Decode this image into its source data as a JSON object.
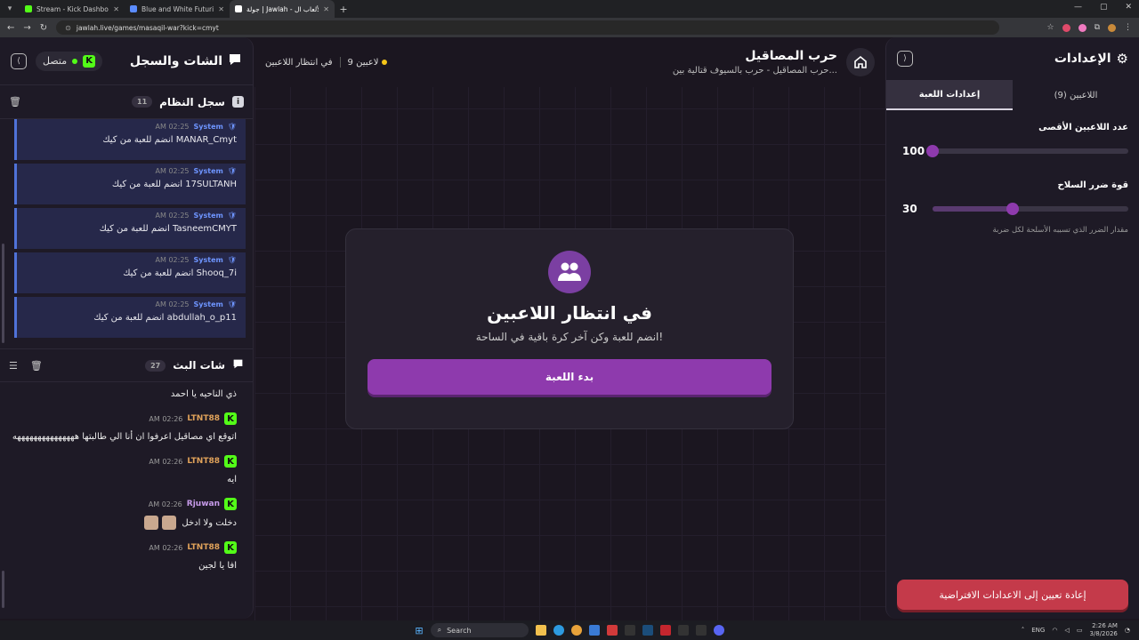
{
  "browser": {
    "tabs": [
      {
        "title": "Stream - Kick Dashboard",
        "color": "#53fc18"
      },
      {
        "title": "Blue and White Futuristic Modi",
        "color": "#5b8cff"
      },
      {
        "title": "جولة | Jawlah - منصة الألعاب ال",
        "color": "#ffffff"
      }
    ],
    "url": "jawlah.live/games/masaqil-war?kick=cmyt"
  },
  "chat_panel": {
    "title": "الشات والسجل",
    "connection": "متصل",
    "system_log": {
      "title": "سجل النظام",
      "count": "11",
      "entries": [
        {
          "sender": "System",
          "time": "02:25 AM",
          "message": "MANAR_Cmyt انضم للعبة من كيك"
        },
        {
          "sender": "System",
          "time": "02:25 AM",
          "message": "17SULTANH انضم للعبة من كيك"
        },
        {
          "sender": "System",
          "time": "02:25 AM",
          "message": "TasneemCMYT انضم للعبة من كيك"
        },
        {
          "sender": "System",
          "time": "02:25 AM",
          "message": "Shooq_7i انضم للعبة من كيك"
        },
        {
          "sender": "System",
          "time": "02:25 AM",
          "message": "abdullah_o_p11 انضم للعبة من كيك"
        }
      ]
    },
    "stream_chat": {
      "title": "شات البث",
      "count": "27",
      "messages": [
        {
          "user": "",
          "time": "",
          "text": "ذي الناحيه يا احمد",
          "color": "#e0a25a"
        },
        {
          "user": "LTNT88",
          "time": "02:26 AM",
          "text": "اتوقع اي مصاقيل اعرفوا ان أنا الي طالبتها هههههههههههههههه",
          "color": "#e0a25a"
        },
        {
          "user": "LTNT88",
          "time": "02:26 AM",
          "text": "ايه",
          "color": "#e0a25a"
        },
        {
          "user": "Rjuwan",
          "time": "02:26 AM",
          "text": "دخلت ولا ادخل",
          "color": "#c79bea"
        },
        {
          "user": "LTNT88",
          "time": "02:26 AM",
          "text": "افا يا لجين",
          "color": "#e0a25a"
        }
      ]
    }
  },
  "game": {
    "title": "حرب المصاقيل",
    "subtitle": "حرب المصاقيل - حرب بالسيوف قتالية بين...",
    "players": "9 لاعبين",
    "status": "في انتظار اللاعبين",
    "card_title": "في انتظار اللاعبين",
    "card_desc": "انضم للعبة وكن آخر كرة باقية في الساحة!",
    "start_label": "بدء اللعبة"
  },
  "settings": {
    "title": "الإعدادات",
    "tabs": [
      "اللاعبين (9)",
      "إعدادات اللعبة"
    ],
    "max_players": {
      "label": "عدد اللاعبين الأقصى",
      "value": "100",
      "fraction": 0.0
    },
    "weapon_damage": {
      "label": "قوة ضرر السلاح",
      "value": "30",
      "fraction": 0.41,
      "hint": "مقدار الضرر الذي تسببه الأسلحة لكل ضربة"
    },
    "reset_label": "إعادة تعيين إلى الاعدادات الافتراضية"
  },
  "taskbar": {
    "search": "Search",
    "lang": "ENG",
    "time": "2:26 AM",
    "date": "3/8/2026"
  }
}
